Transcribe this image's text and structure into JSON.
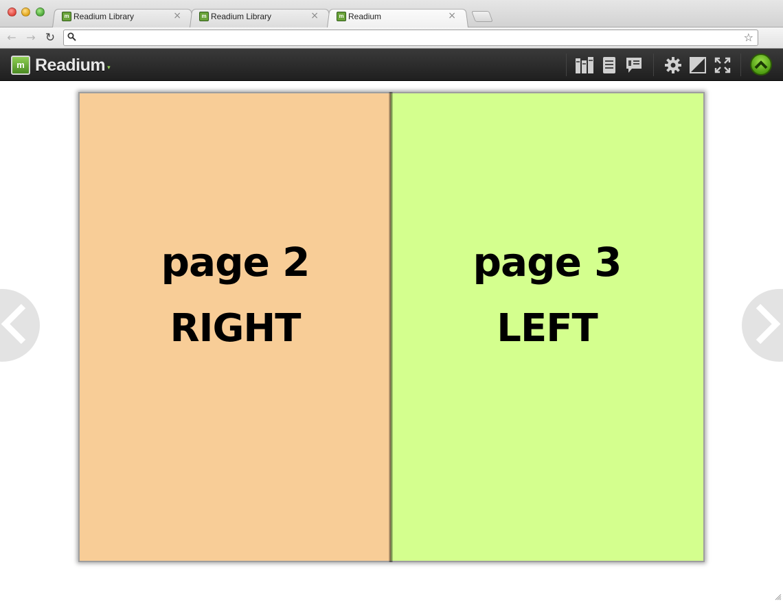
{
  "browser": {
    "tabs": [
      {
        "label": "Readium Library",
        "favicon": "readium-favicon",
        "active": false
      },
      {
        "label": "Readium Library",
        "favicon": "readium-favicon",
        "active": false
      },
      {
        "label": "Readium",
        "favicon": "readium-favicon",
        "active": true
      }
    ],
    "close_glyph": "×",
    "address": {
      "value": "",
      "placeholder": ""
    },
    "icons": [
      "back-icon",
      "forward-icon",
      "reload-icon",
      "search-icon",
      "star-icon",
      "extension-icon"
    ]
  },
  "app": {
    "logo_mark": "m",
    "title": "Readium",
    "toolbar_icons": [
      "library-icon",
      "toc-icon",
      "notes-icon",
      "settings-icon",
      "theme-contrast-icon",
      "fullscreen-icon",
      "scroll-top-icon"
    ],
    "accent_color": "#6aa33a"
  },
  "reader": {
    "pages": [
      {
        "title": "page 2",
        "side": "RIGHT",
        "color": "#f8cd97"
      },
      {
        "title": "page 3",
        "side": "LEFT",
        "color": "#d4ff8e"
      }
    ],
    "nav_icons": [
      "chevron-left-icon",
      "chevron-right-icon"
    ]
  }
}
